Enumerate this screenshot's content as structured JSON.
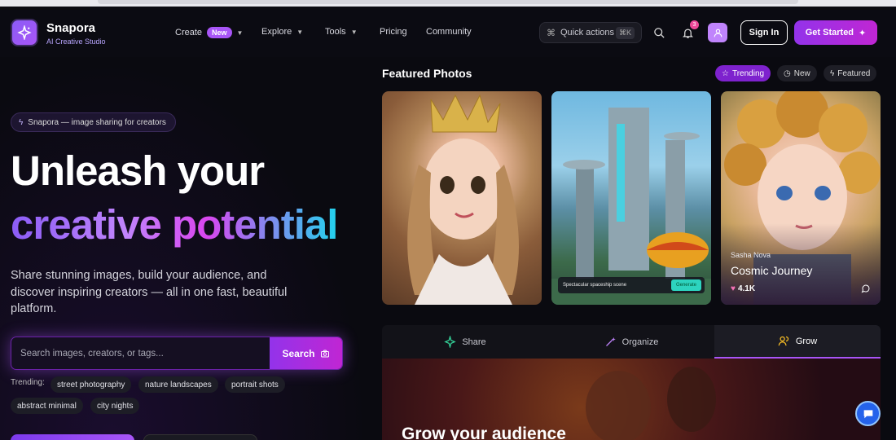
{
  "brand": {
    "name": "Snapora",
    "tagline": "AI Creative Studio"
  },
  "nav": {
    "create": "Create",
    "create_badge": "New",
    "explore": "Explore",
    "tools": "Tools",
    "pricing": "Pricing",
    "community": "Community"
  },
  "header": {
    "quick_actions": "Quick actions",
    "quick_shortcut": "⌘K",
    "notification_count": "3",
    "sign_in": "Sign In",
    "get_started": "Get Started"
  },
  "hero": {
    "pill": "Snapora — image sharing for creators",
    "title_line1": "Unleash your",
    "title_line2": "creative potential",
    "subtitle": "Share stunning images, build your audience, and discover inspiring creators — all in one fast, beautiful platform.",
    "search_placeholder": "Search images, creators, or tags...",
    "search_button": "Search",
    "trending_label": "Trending:",
    "trending_tags": [
      "street photography",
      "nature landscapes",
      "portrait shots",
      "abstract minimal",
      "city nights"
    ]
  },
  "featured": {
    "title": "Featured Photos",
    "tabs": [
      "Trending",
      "New",
      "Featured"
    ],
    "card2_caption": "Spectacular spaceship scene",
    "card2_button": "Generate",
    "card3": {
      "author": "Sasha Nova",
      "title": "Cosmic Journey",
      "likes": "4.1K"
    }
  },
  "feature_tabs": [
    "Share",
    "Organize",
    "Grow"
  ],
  "panel": {
    "title": "Grow your audience"
  },
  "colors": {
    "accent": "#a855f7",
    "accent_dark": "#7e22ce",
    "background": "#0a0a10"
  }
}
